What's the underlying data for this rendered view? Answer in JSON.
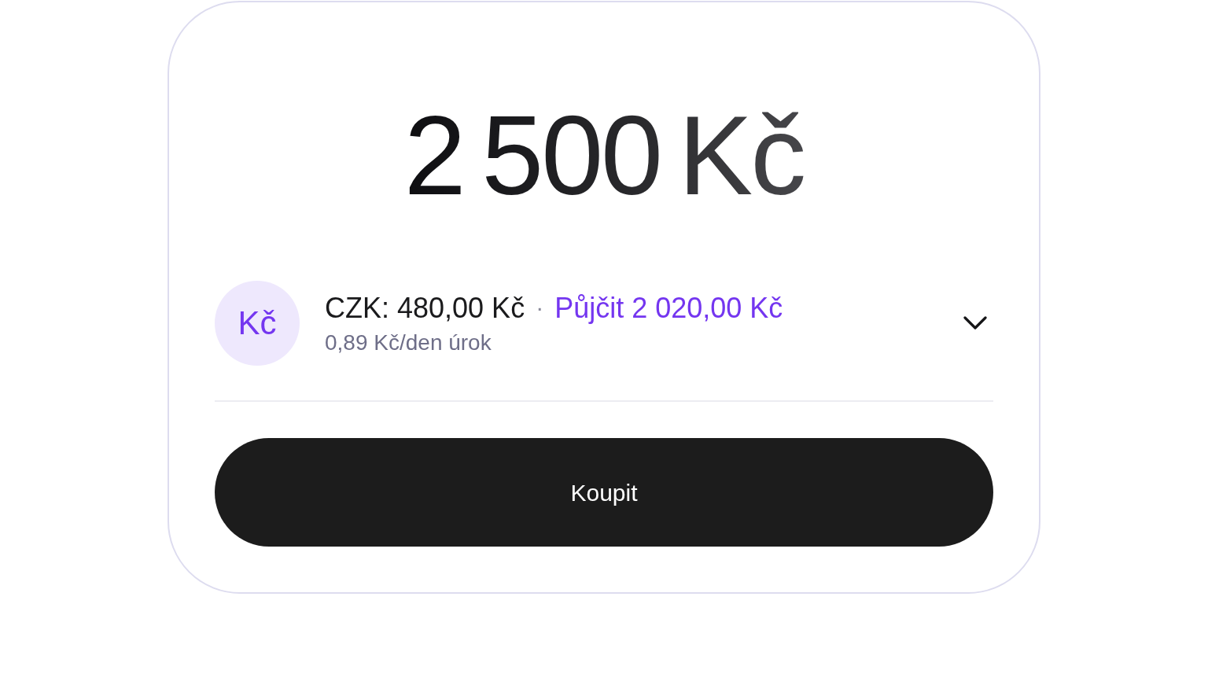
{
  "amount": "2 500 Kč",
  "balance_row": {
    "currency_badge": "Kč",
    "balance": "CZK: 480,00 Kč",
    "separator": "·",
    "borrow_link": "Půjčit 2 020,00 Kč",
    "interest": "0,89 Kč/den úrok",
    "expanded": false
  },
  "buy_button": {
    "label": "Koupit"
  }
}
